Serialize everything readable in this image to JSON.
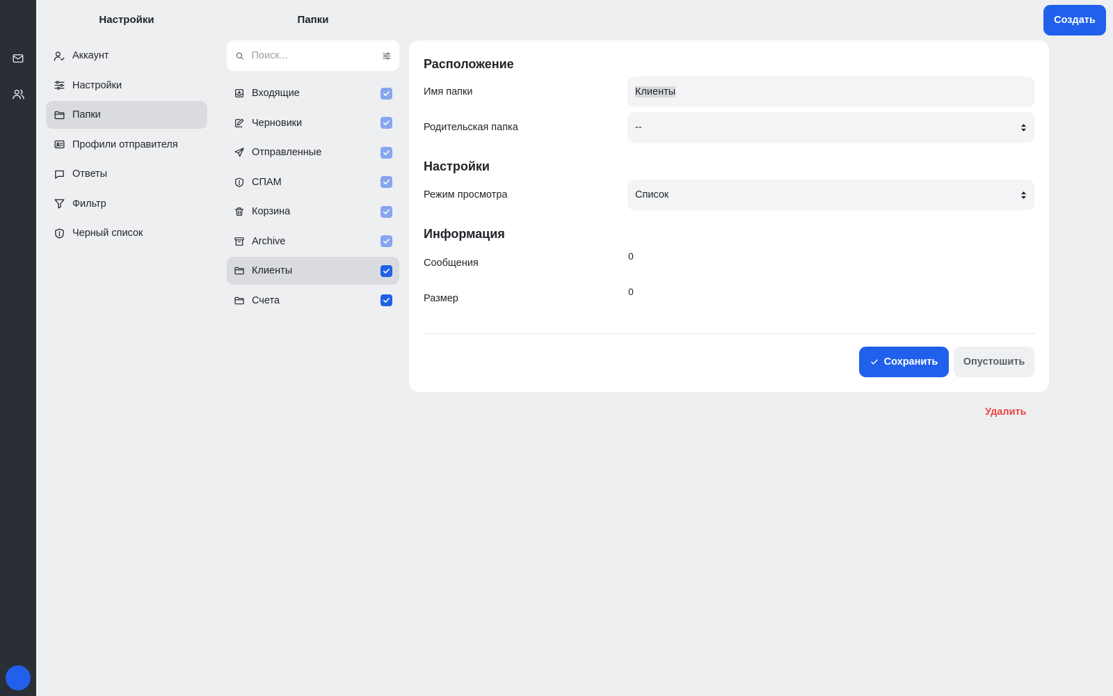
{
  "rail": {
    "icons": [
      "mail-icon",
      "users-icon"
    ],
    "avatar_color": "#2160ea"
  },
  "settings_column": {
    "title": "Настройки",
    "items": [
      {
        "label": "Аккаунт",
        "icon": "user-icon",
        "active": false
      },
      {
        "label": "Настройки",
        "icon": "sliders-icon",
        "active": false
      },
      {
        "label": "Папки",
        "icon": "folder-icon",
        "active": true
      },
      {
        "label": "Профили отправителя",
        "icon": "id-card-icon",
        "active": false
      },
      {
        "label": "Ответы",
        "icon": "chat-bubble-icon",
        "active": false
      },
      {
        "label": "Фильтр",
        "icon": "filter-icon",
        "active": false
      },
      {
        "label": "Черный список",
        "icon": "shield-icon",
        "active": false
      }
    ]
  },
  "folders_column": {
    "title": "Папки",
    "search_placeholder": "Поиск...",
    "items": [
      {
        "label": "Входящие",
        "icon": "inbox-icon",
        "checked": true,
        "dimmed": true,
        "active": false
      },
      {
        "label": "Черновики",
        "icon": "draft-pen-icon",
        "checked": true,
        "dimmed": true,
        "active": false
      },
      {
        "label": "Отправленные",
        "icon": "send-icon",
        "checked": true,
        "dimmed": true,
        "active": false
      },
      {
        "label": "СПАМ",
        "icon": "shield-alert-icon",
        "checked": true,
        "dimmed": true,
        "active": false
      },
      {
        "label": "Корзина",
        "icon": "trash-icon",
        "checked": true,
        "dimmed": true,
        "active": false
      },
      {
        "label": "Archive",
        "icon": "archive-icon",
        "checked": true,
        "dimmed": true,
        "active": false
      },
      {
        "label": "Клиенты",
        "icon": "folder-icon",
        "checked": true,
        "dimmed": false,
        "active": true
      },
      {
        "label": "Счета",
        "icon": "folder-icon",
        "checked": true,
        "dimmed": false,
        "active": false
      }
    ]
  },
  "form": {
    "location_heading": "Расположение",
    "folder_name_label": "Имя папки",
    "folder_name_value": "Клиенты",
    "parent_label": "Родительская папка",
    "parent_value": "--",
    "settings_heading": "Настройки",
    "view_mode_label": "Режим просмотра",
    "view_mode_value": "Список",
    "info_heading": "Информация",
    "messages_label": "Сообщения",
    "messages_value": "0",
    "size_label": "Размер",
    "size_value": "0",
    "save_label": "Сохранить",
    "empty_label": "Опустошить",
    "delete_label": "Удалить"
  },
  "create_label": "Создать",
  "colors": {
    "accent": "#2160ea",
    "danger": "#ee4444",
    "rail": "#2a2e35",
    "background": "#eeeff1"
  }
}
